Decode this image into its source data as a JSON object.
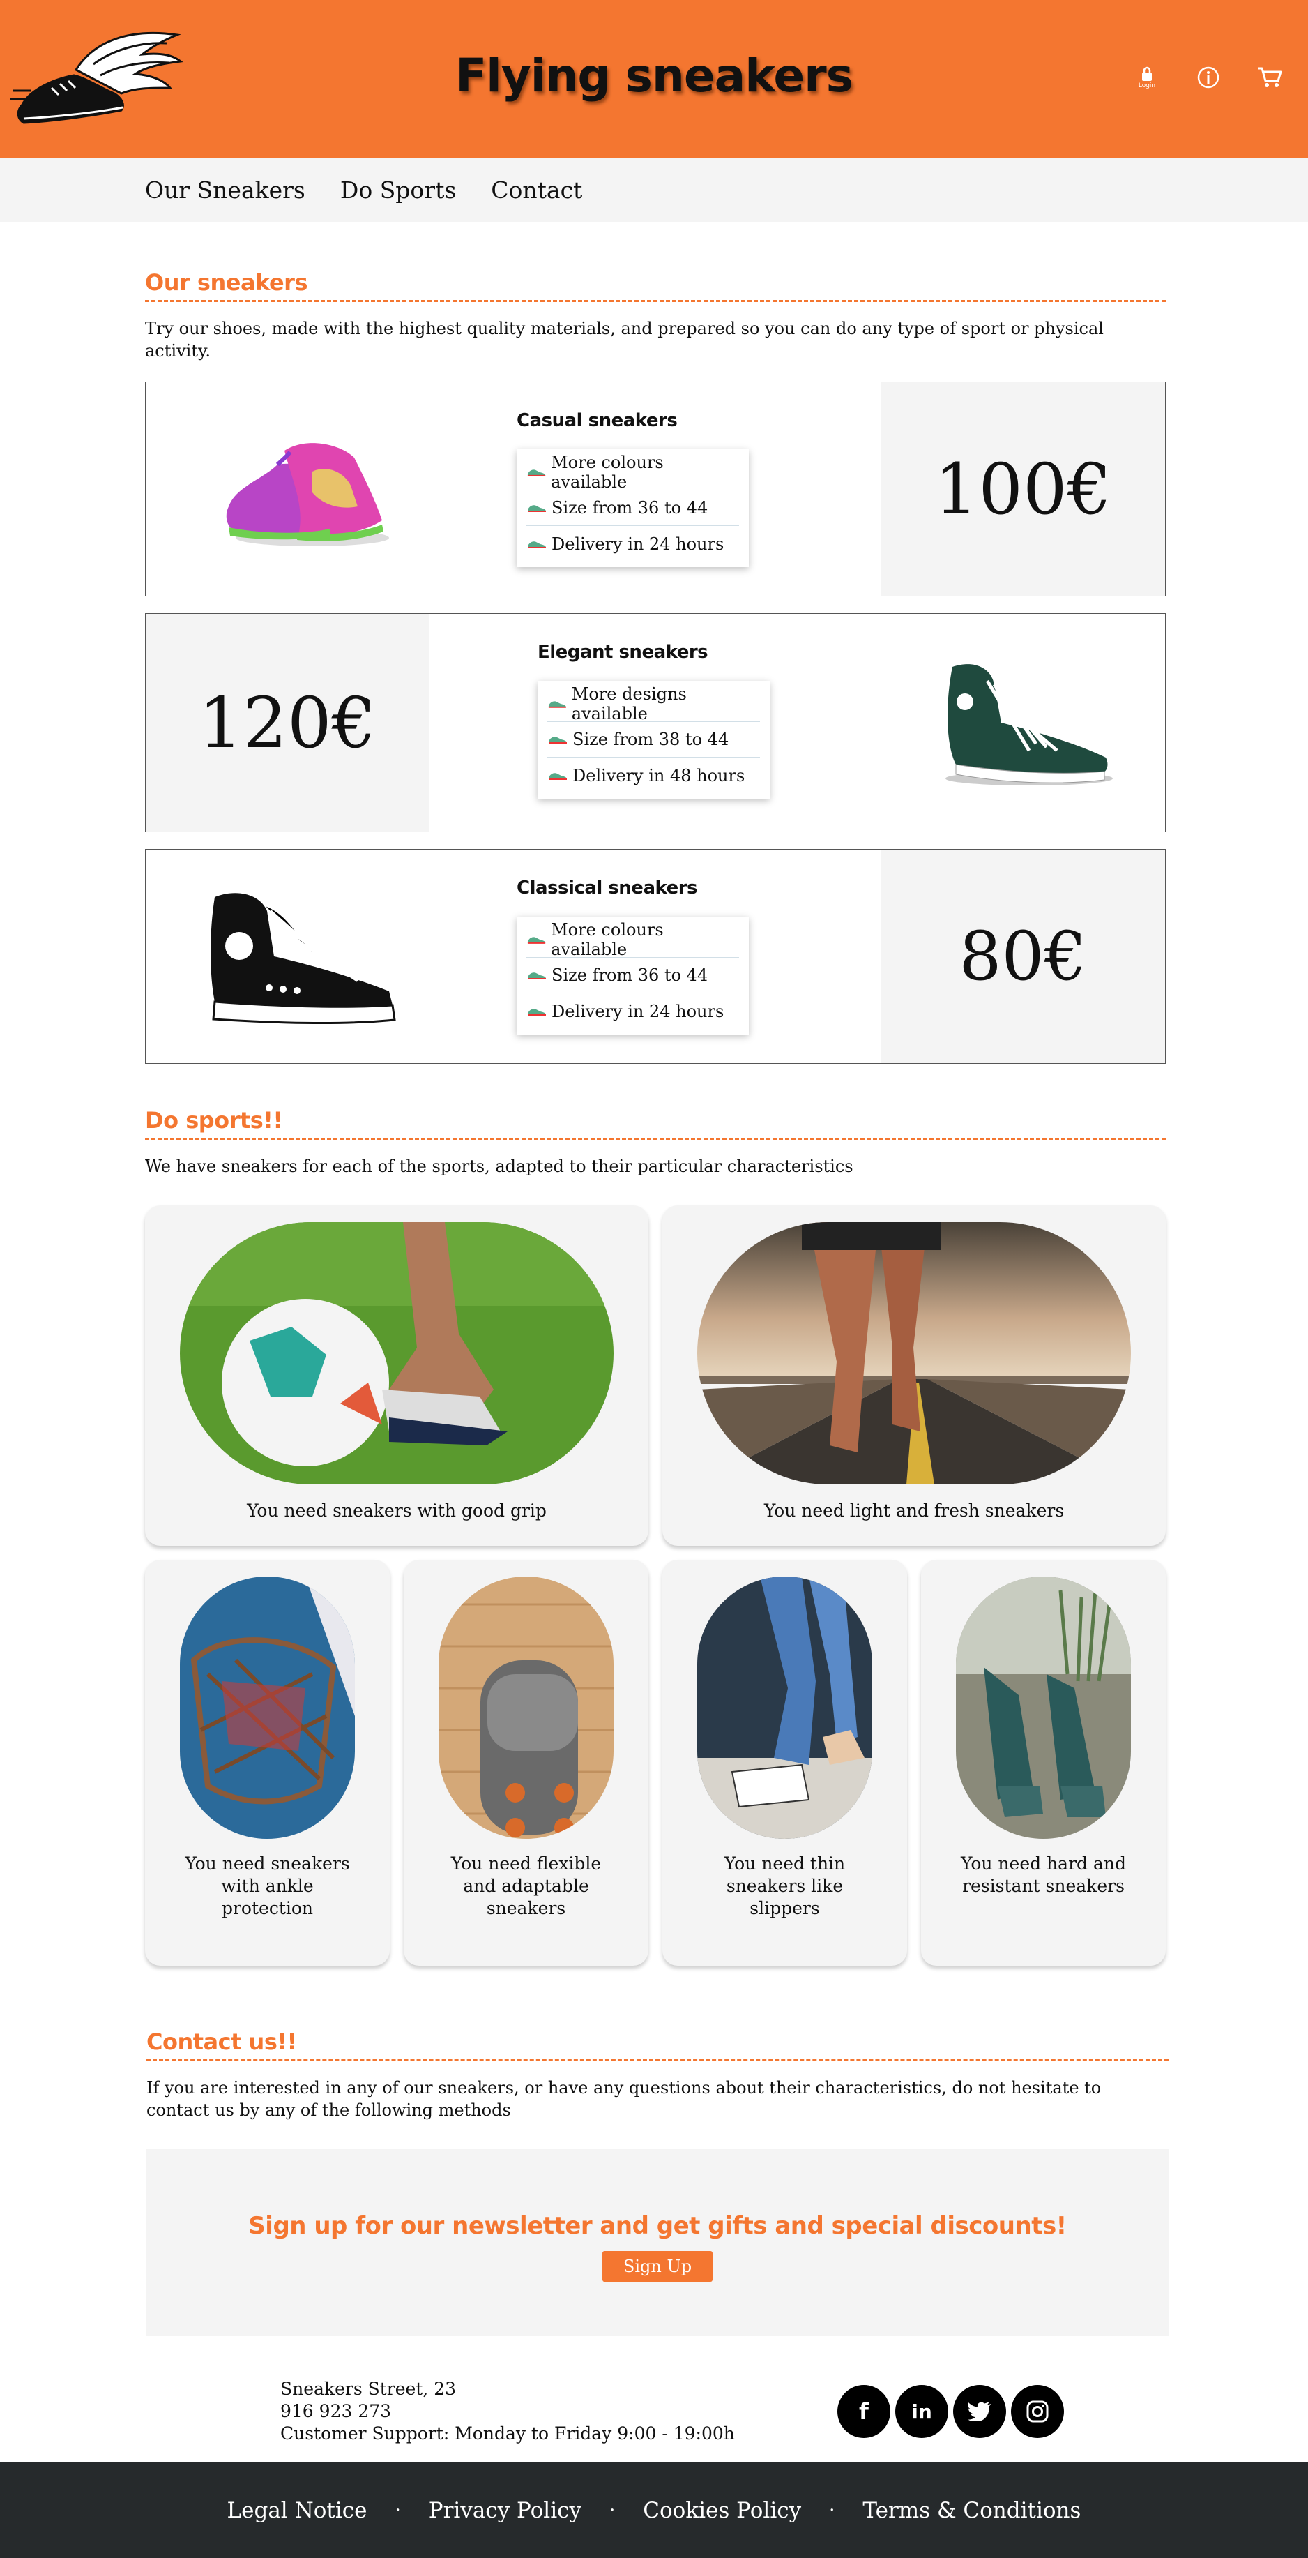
{
  "header": {
    "title": "Flying sneakers",
    "login_label": "Login"
  },
  "nav": [
    "Our Sneakers",
    "Do Sports",
    "Contact"
  ],
  "sneakers": {
    "title": "Our sneakers",
    "description": "Try our shoes, made with the highest quality materials, and prepared so you can do any type of sport or physical activity.",
    "products": [
      {
        "name": "Casual sneakers",
        "price": "100€",
        "features": [
          "More colours available",
          "Size from 36 to 44",
          "Delivery in 24 hours"
        ]
      },
      {
        "name": "Elegant sneakers",
        "price": "120€",
        "features": [
          "More designs available",
          "Size from 38 to 44",
          "Delivery in 48 hours"
        ]
      },
      {
        "name": "Classical sneakers",
        "price": "80€",
        "features": [
          "More colours available",
          "Size from 36 to 44",
          "Delivery in 24 hours"
        ]
      }
    ]
  },
  "sports": {
    "title": "Do sports!!",
    "description": "We have sneakers for each of the sports, adapted to their particular characteristics",
    "cards": [
      "You need sneakers with good grip",
      "You need light and fresh sneakers",
      "You need sneakers with ankle protection",
      "You need flexible and adaptable sneakers",
      "You need thin sneakers like slippers",
      "You need hard and resistant sneakers"
    ]
  },
  "contact": {
    "title": "Contact us!!",
    "description": "If you are interested in any of our sneakers, or have any questions about their characteristics, do not hesitate to contact us by any of the following methods",
    "newsletter_title": "Sign up for our newsletter and get gifts and special discounts!",
    "signup_label": "Sign Up",
    "address": [
      "Sneakers Street, 23",
      "916 923 273",
      "Customer Support: Monday to Friday 9:00 - 19:00h"
    ],
    "socials": [
      "facebook",
      "linkedin",
      "twitter",
      "instagram"
    ]
  },
  "footer": [
    "Legal Notice",
    "Privacy Policy",
    "Cookies Policy",
    "Terms & Conditions"
  ],
  "colors": {
    "accent": "#f47630",
    "panel": "#f4f4f4",
    "footer": "#262a2c"
  }
}
